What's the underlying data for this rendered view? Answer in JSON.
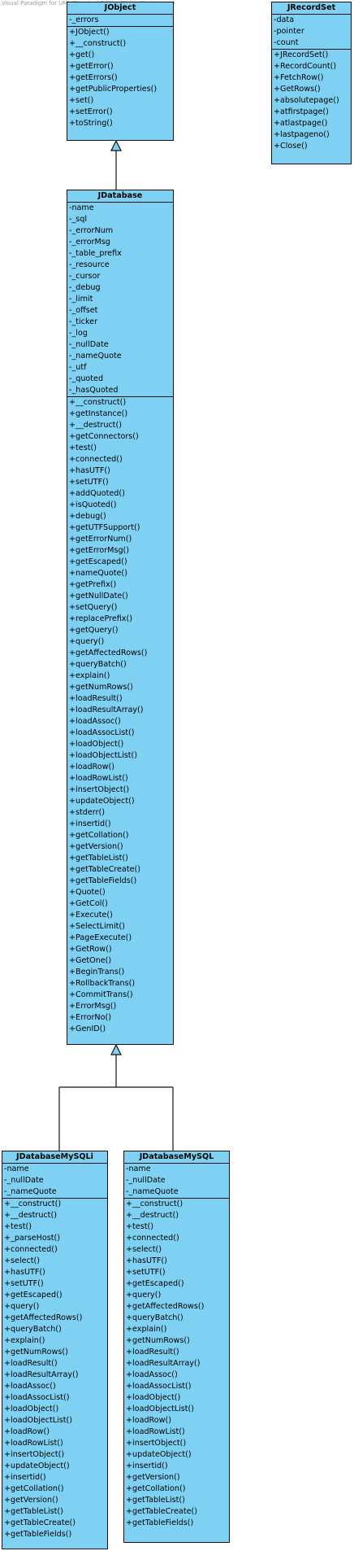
{
  "watermark": "Visual Paradigm for UML Standard Edition(Aidan MacLennan)",
  "classes": [
    {
      "name": "JObject",
      "attributes": [
        "-_errors"
      ],
      "operations": [
        "+JObject()",
        "+__construct()",
        "+get()",
        "+getError()",
        "+getErrors()",
        "+getPublicProperties()",
        "+set()",
        "+setError()",
        "+toString()"
      ]
    },
    {
      "name": "JRecordSet",
      "attributes": [
        "-data",
        "-pointer",
        "-count"
      ],
      "operations": [
        "+JRecordSet()",
        "+RecordCount()",
        "+FetchRow()",
        "+GetRows()",
        "+absolutepage()",
        "+atfirstpage()",
        "+atlastpage()",
        "+lastpageno()",
        "+Close()"
      ]
    },
    {
      "name": "JDatabase",
      "attributes": [
        "-name",
        "-_sql",
        "-_errorNum",
        "-_errorMsg",
        "-_table_prefix",
        "-_resource",
        "-_cursor",
        "-_debug",
        "-_limit",
        "-_offset",
        "-_ticker",
        "-_log",
        "-_nullDate",
        "-_nameQuote",
        "-_utf",
        "-_quoted",
        "-_hasQuoted"
      ],
      "operations": [
        "+__construct()",
        "+getInstance()",
        "+__destruct()",
        "+getConnectors()",
        "+test()",
        "+connected()",
        "+hasUTF()",
        "+setUTF()",
        "+addQuoted()",
        "+isQuoted()",
        "+debug()",
        "+getUTFSupport()",
        "+getErrorNum()",
        "+getErrorMsg()",
        "+getEscaped()",
        "+nameQuote()",
        "+getPrefix()",
        "+getNullDate()",
        "+setQuery()",
        "+replacePrefix()",
        "+getQuery()",
        "+query()",
        "+getAffectedRows()",
        "+queryBatch()",
        "+explain()",
        "+getNumRows()",
        "+loadResult()",
        "+loadResultArray()",
        "+loadAssoc()",
        "+loadAssocList()",
        "+loadObject()",
        "+loadObjectList()",
        "+loadRow()",
        "+loadRowList()",
        "+insertObject()",
        "+updateObject()",
        "+stderr()",
        "+insertid()",
        "+getCollation()",
        "+getVersion()",
        "+getTableList()",
        "+getTableCreate()",
        "+getTableFields()",
        "+Quote()",
        "+GetCol()",
        "+Execute()",
        "+SelectLimit()",
        "+PageExecute()",
        "+GetRow()",
        "+GetOne()",
        "+BeginTrans()",
        "+RollbackTrans()",
        "+CommitTrans()",
        "+ErrorMsg()",
        "+ErrorNo()",
        "+GenID()"
      ]
    },
    {
      "name": "JDatabaseMySQLi",
      "attributes": [
        "-name",
        "-_nullDate",
        "-_nameQuote"
      ],
      "operations": [
        "+__construct()",
        "+__destruct()",
        "+test()",
        "+_parseHost()",
        "+connected()",
        "+select()",
        "+hasUTF()",
        "+setUTF()",
        "+getEscaped()",
        "+query()",
        "+getAffectedRows()",
        "+queryBatch()",
        "+explain()",
        "+getNumRows()",
        "+loadResult()",
        "+loadResultArray()",
        "+loadAssoc()",
        "+loadAssocList()",
        "+loadObject()",
        "+loadObjectList()",
        "+loadRow()",
        "+loadRowList()",
        "+insertObject()",
        "+updateObject()",
        "+insertid()",
        "+getCollation()",
        "+getVersion()",
        "+getTableList()",
        "+getTableCreate()",
        "+getTableFields()"
      ]
    },
    {
      "name": "JDatabaseMySQL",
      "attributes": [
        "-name",
        "-_nullDate",
        "-_nameQuote"
      ],
      "operations": [
        "+__construct()",
        "+__destruct()",
        "+test()",
        "+connected()",
        "+select()",
        "+hasUTF()",
        "+setUTF()",
        "+getEscaped()",
        "+query()",
        "+getAffectedRows()",
        "+queryBatch()",
        "+explain()",
        "+getNumRows()",
        "+loadResult()",
        "+loadResultArray()",
        "+loadAssoc()",
        "+loadAssocList()",
        "+loadObject()",
        "+loadObjectList()",
        "+loadRow()",
        "+loadRowList()",
        "+insertObject()",
        "+updateObject()",
        "+insertid()",
        "+getVersion()",
        "+getCollation()",
        "+getTableList()",
        "+getTableCreate()",
        "+getTableFields()"
      ]
    }
  ],
  "colors": {
    "class_fill": "#7ed1f2",
    "line": "#111111"
  }
}
